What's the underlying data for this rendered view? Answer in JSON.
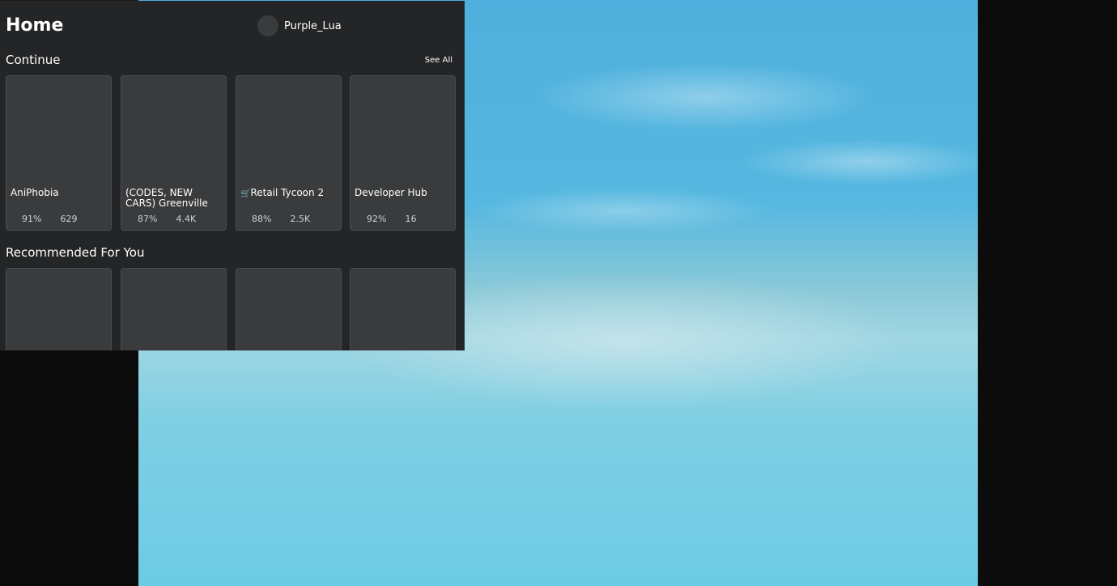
{
  "header": {
    "title": "Home",
    "username": "Purple_Lua"
  },
  "continue": {
    "title": "Continue",
    "see_all": "See All",
    "games": [
      {
        "name": "AniPhobia",
        "rating": "91%",
        "players": "629"
      },
      {
        "name": "(CODES, NEW CARS) Greenville",
        "rating": "87%",
        "players": "4.4K"
      },
      {
        "name": "Retail Tycoon 2",
        "icon": "cart-icon",
        "rating": "88%",
        "players": "2.5K"
      },
      {
        "name": "Developer Hub",
        "rating": "92%",
        "players": "16"
      }
    ]
  },
  "recommended": {
    "title": "Recommended For You"
  },
  "colors": {
    "panel": "#232527",
    "card": "#393b3d",
    "text": "#ffffff"
  }
}
